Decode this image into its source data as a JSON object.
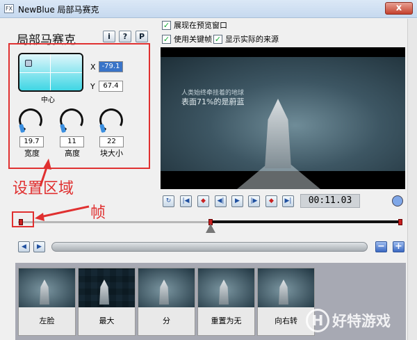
{
  "window": {
    "title": "NewBlue 局部马赛克",
    "app_icon": "FX",
    "close": "x"
  },
  "left_panel": {
    "effect_title": "局部马赛克",
    "buttons": {
      "info": "i",
      "help": "?",
      "preset": "P"
    },
    "position": {
      "center_label": "中心",
      "x_label": "X",
      "x_value": "-79.1",
      "y_label": "Y",
      "y_value": "67.4"
    },
    "knobs": [
      {
        "value": "19.7",
        "label": "宽度"
      },
      {
        "value": "11",
        "label": "高度"
      },
      {
        "value": "22",
        "label": "块大小"
      }
    ]
  },
  "options": {
    "show_in_preview": "展现在预览窗口",
    "use_keyframes": "使用关键帧",
    "show_actual_source": "显示实际的来源"
  },
  "preview": {
    "caption_line1": "人类始终牵挂着的地球",
    "caption_line2": "表面71%的是蔚蓝"
  },
  "transport": {
    "timecode": "00:11.03",
    "buttons": [
      "↻",
      "|◀",
      "◆",
      "◀|",
      "▶",
      "|▶",
      "◆",
      "▶|"
    ]
  },
  "nav": {
    "prev": "◀",
    "next": "▶",
    "minus": "−",
    "plus": "+"
  },
  "presets": [
    {
      "label": "左脸"
    },
    {
      "label": "最大"
    },
    {
      "label": "分"
    },
    {
      "label": "重置为无"
    },
    {
      "label": "向右转"
    }
  ],
  "annotations": {
    "region": "设置区域",
    "frame": "帧"
  },
  "watermark": {
    "logo": "H",
    "text": "好特游戏"
  }
}
